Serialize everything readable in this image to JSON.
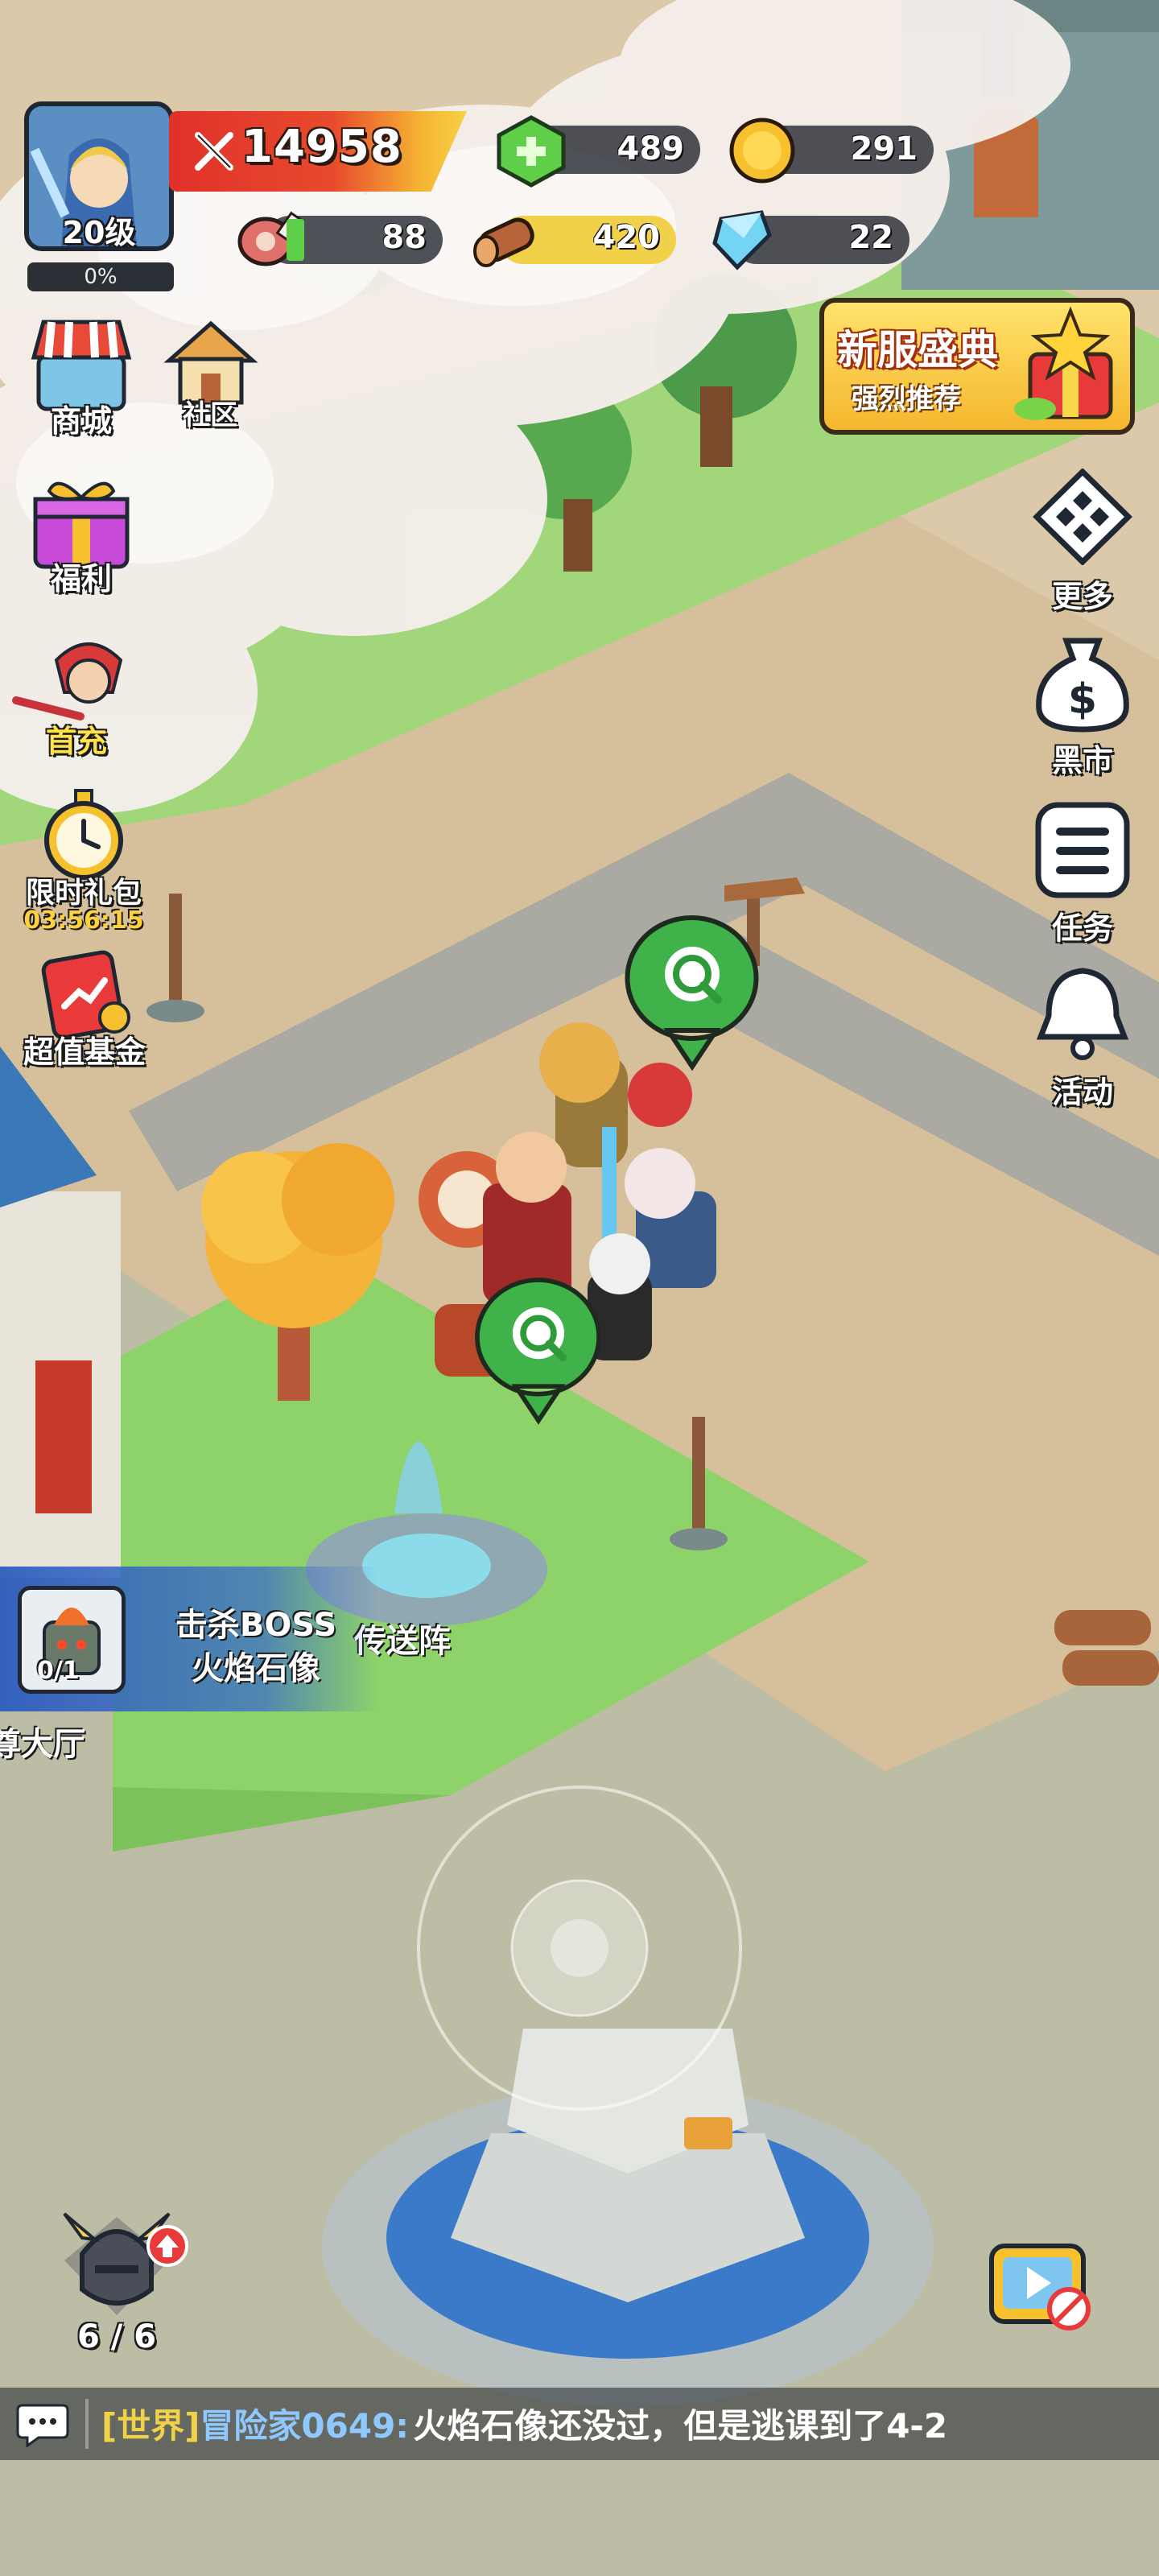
{
  "player": {
    "level_label": "20级",
    "xp_percent_label": "0%",
    "xp_fraction": 0.0
  },
  "power": {
    "value": "14958"
  },
  "resources": {
    "gems": "489",
    "gold": "291",
    "meat": "88",
    "wood": "420",
    "crystal": "22"
  },
  "left_menu": {
    "shop": "商城",
    "community": "社区",
    "welfare": "福利",
    "first_charge": "首充",
    "limited_gift": "限时礼包",
    "limited_gift_timer": "03:56:15",
    "value_fund": "超值基金"
  },
  "right_menu": {
    "more": "更多",
    "black_market": "黑市",
    "tasks": "任务",
    "events": "活动"
  },
  "promo": {
    "title": "新服盛典",
    "subtitle": "强烈推荐"
  },
  "quest": {
    "progress": "0/1",
    "line1": "击杀BOSS",
    "line2": "火焰石像"
  },
  "map_labels": {
    "teleport": "传送阵",
    "hall": "尊大厅"
  },
  "heroes_count": "6 / 6",
  "chat": {
    "channel": "[世界]",
    "sender": "冒险家0649:",
    "message": "火焰石像还没过，但是逃课到了4-2"
  },
  "colors": {
    "power_red": "#e0312b",
    "chat_channel": "#f0d24a",
    "chat_sender": "#8fc8ff",
    "timer": "#ffd23a",
    "first_charge_label": "#ffe24a"
  }
}
